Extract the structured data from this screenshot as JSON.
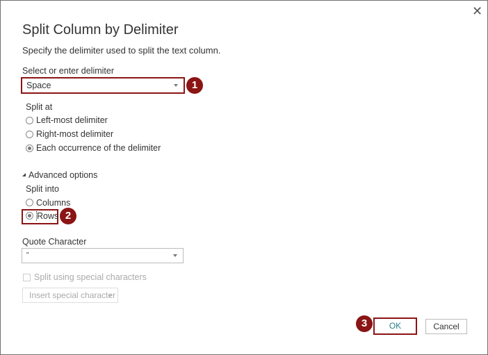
{
  "dialog": {
    "title": "Split Column by Delimiter",
    "subtitle": "Specify the delimiter used to split the text column.",
    "close_icon": "close-icon"
  },
  "delimiter": {
    "label": "Select or enter delimiter",
    "value": "Space"
  },
  "split_at": {
    "label": "Split at",
    "options": [
      "Left-most delimiter",
      "Right-most delimiter",
      "Each occurrence of the delimiter"
    ],
    "selected": "Each occurrence of the delimiter"
  },
  "advanced": {
    "label": "Advanced options",
    "split_into_label": "Split into",
    "options": [
      "Columns",
      "Rows"
    ],
    "selected": "Rows"
  },
  "quote": {
    "label": "Quote Character",
    "value": "\""
  },
  "special": {
    "checkbox_label": "Split using special characters",
    "insert_label": "Insert special character"
  },
  "buttons": {
    "ok": "OK",
    "cancel": "Cancel"
  },
  "annotations": [
    "1",
    "2",
    "3"
  ],
  "colors": {
    "highlight": "#8b1414"
  }
}
